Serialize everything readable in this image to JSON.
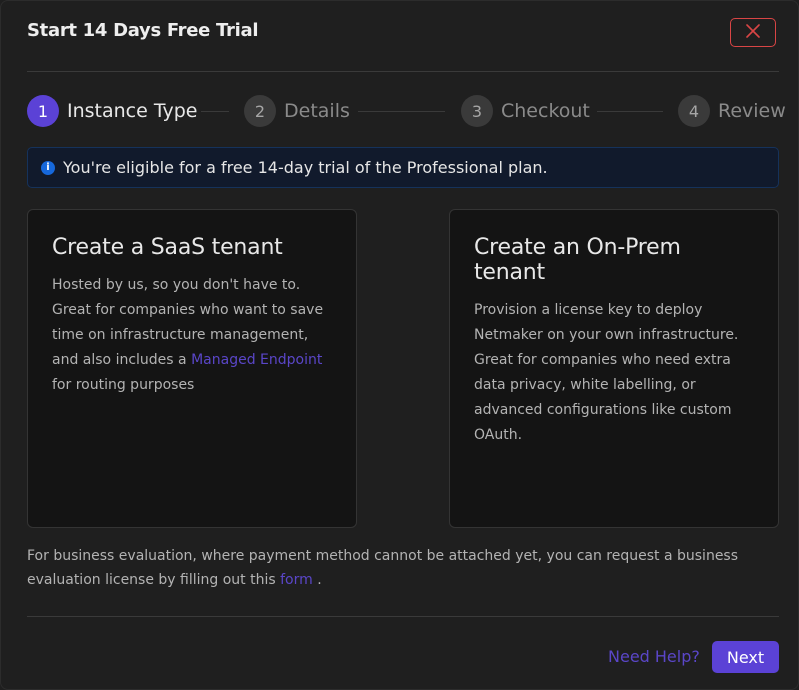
{
  "dialog": {
    "title": "Start 14 Days Free Trial",
    "close_icon": "close-icon",
    "close_color": "#d84545"
  },
  "steps": [
    {
      "number": "1",
      "label": "Instance Type",
      "active": true
    },
    {
      "number": "2",
      "label": "Details",
      "active": false
    },
    {
      "number": "3",
      "label": "Checkout",
      "active": false
    },
    {
      "number": "4",
      "label": "Review",
      "active": false
    }
  ],
  "alert": {
    "icon": "info-icon",
    "text": "You're eligible for a free 14-day trial of the Professional plan."
  },
  "cards": {
    "saas": {
      "title": "Create a SaaS tenant",
      "desc_before": "Hosted by us, so you don't have to. Great for companies who want to save time on infrastructure management, and also includes a ",
      "link": "Managed Endpoint",
      "desc_after": " for routing purposes"
    },
    "onprem": {
      "title": "Create an On-Prem tenant",
      "desc": "Provision a license key to deploy Netmaker on your own infrastructure. Great for companies who need extra data privacy, white labelling, or advanced configurations like custom OAuth."
    }
  },
  "footnote": {
    "text_before": "For business evaluation, where payment method cannot be attached yet, you can request a business evaluation license by filling out this ",
    "link": "form",
    "text_after": " ."
  },
  "footer": {
    "help_label": "Need Help?",
    "next_label": "Next"
  },
  "colors": {
    "accent": "#5b42d6",
    "link": "#5a46c8",
    "info": "#1668dc",
    "background": "#1f1f1f"
  }
}
